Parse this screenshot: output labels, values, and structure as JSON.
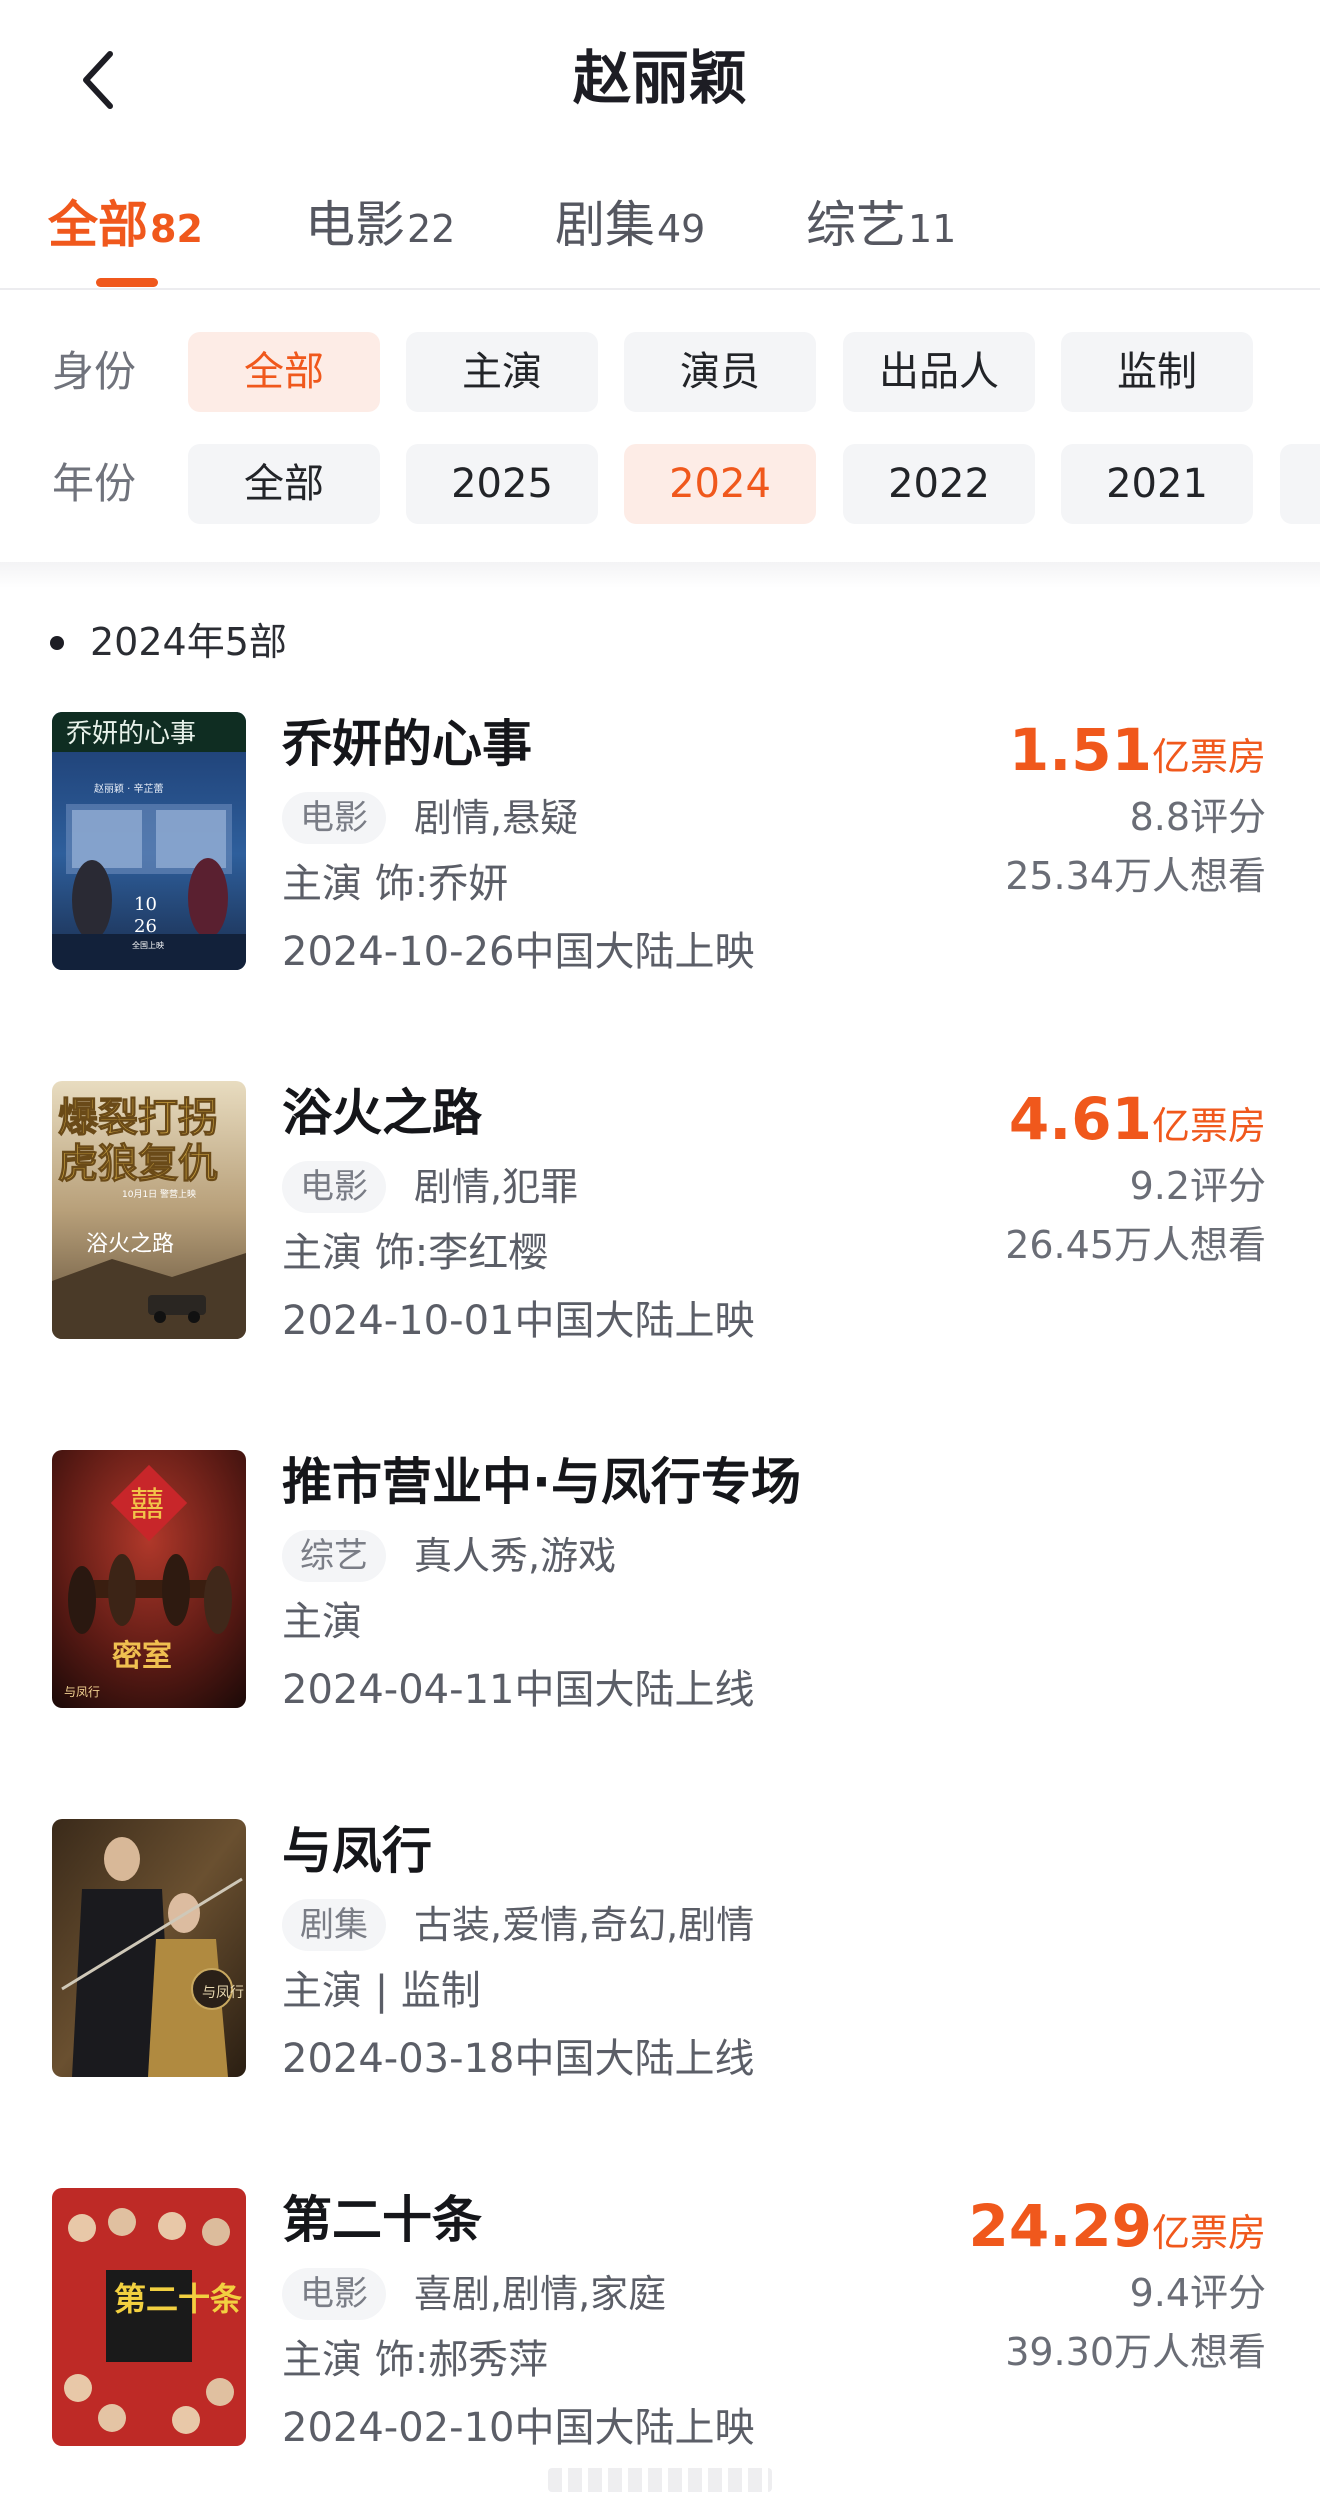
{
  "header": {
    "title": "赵丽颖"
  },
  "tabs": [
    {
      "name": "全部",
      "count": "82"
    },
    {
      "name": "电影",
      "count": "22"
    },
    {
      "name": "剧集",
      "count": "49"
    },
    {
      "name": "综艺",
      "count": "11"
    }
  ],
  "filters": {
    "identity": {
      "label": "身份",
      "options": [
        "全部",
        "主演",
        "演员",
        "出品人",
        "监制"
      ],
      "selected": "全部"
    },
    "year": {
      "label": "年份",
      "options": [
        "全部",
        "2025",
        "2024",
        "2022",
        "2021"
      ],
      "selected": "2024"
    }
  },
  "section": {
    "title": "2024年5部"
  },
  "items": [
    {
      "title": "乔妍的心事",
      "type": "电影",
      "genres": "剧情,悬疑",
      "role": "主演 饰:乔妍",
      "release": "2024-10-26中国大陆上映",
      "box_office": "1.51",
      "box_unit": "亿票房",
      "score": "8.8评分",
      "want": "25.34万人想看",
      "poster_text": [
        "乔妍的心事",
        "赵丽颖 · 辛芷蕾",
        "10",
        "26",
        "全国上映"
      ]
    },
    {
      "title": "浴火之路",
      "type": "电影",
      "genres": "剧情,犯罪",
      "role": "主演 饰:李红樱",
      "release": "2024-10-01中国大陆上映",
      "box_office": "4.61",
      "box_unit": "亿票房",
      "score": "9.2评分",
      "want": "26.45万人想看",
      "poster_text": [
        "爆裂打拐",
        "虎狼复仇",
        "10月1日 警营上映",
        "浴火之路"
      ]
    },
    {
      "title": "推市营业中·与凤行专场",
      "type": "综艺",
      "genres": "真人秀,游戏",
      "role": "主演",
      "release": "2024-04-11中国大陆上线",
      "poster_text": [
        "囍",
        "密室",
        "与凤行"
      ]
    },
    {
      "title": "与凤行",
      "type": "剧集",
      "genres": "古装,爱情,奇幻,剧情",
      "role": "主演 | 监制",
      "release": "2024-03-18中国大陆上线",
      "poster_text": [
        "与凤行"
      ]
    },
    {
      "title": "第二十条",
      "type": "电影",
      "genres": "喜剧,剧情,家庭",
      "role": "主演 饰:郝秀萍",
      "release": "2024-02-10中国大陆上映",
      "box_office": "24.29",
      "box_unit": "亿票房",
      "score": "9.4评分",
      "want": "39.30万人想看",
      "poster_text": [
        "第二十条"
      ]
    }
  ],
  "colors": {
    "accent": "#f0581c",
    "chip_bg": "#f4f5f7",
    "chip_selected_bg": "#fdece6"
  },
  "icons": {
    "back": "chevron-left-icon"
  }
}
